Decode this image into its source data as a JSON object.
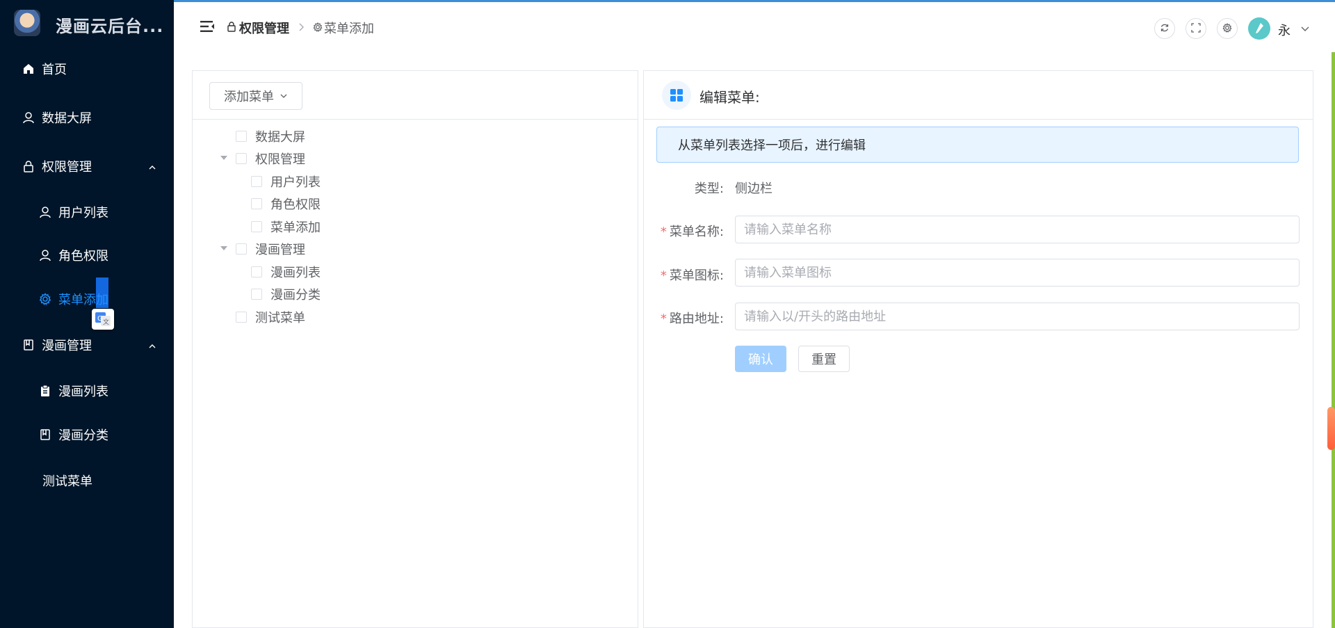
{
  "app": {
    "title": "漫画云后台..."
  },
  "sidebar": {
    "items": [
      {
        "label": "首页",
        "icon": "home-icon"
      },
      {
        "label": "数据大屏",
        "icon": "user-icon"
      },
      {
        "label": "权限管理",
        "icon": "lock-icon",
        "expanded": true
      },
      {
        "label": "用户列表",
        "icon": "user-icon"
      },
      {
        "label": "角色权限",
        "icon": "user-icon"
      },
      {
        "label": "菜单添加",
        "icon": "gear-icon",
        "active": true
      },
      {
        "label": "漫画管理",
        "icon": "book-icon",
        "expanded": true
      },
      {
        "label": "漫画列表",
        "icon": "clipboard-icon"
      },
      {
        "label": "漫画分类",
        "icon": "book-icon"
      },
      {
        "label": "测试菜单",
        "icon": ""
      }
    ],
    "accent_color": "#1e90ff",
    "background": "#001529"
  },
  "header": {
    "breadcrumb": [
      "权限管理",
      "菜单添加"
    ],
    "username": "永"
  },
  "tree_panel": {
    "add_button": "添加菜单",
    "nodes": [
      {
        "label": "数据大屏",
        "level": 0,
        "has_children": false
      },
      {
        "label": "权限管理",
        "level": 0,
        "has_children": true
      },
      {
        "label": "用户列表",
        "level": 1,
        "has_children": false
      },
      {
        "label": "角色权限",
        "level": 1,
        "has_children": false
      },
      {
        "label": "菜单添加",
        "level": 1,
        "has_children": false
      },
      {
        "label": "漫画管理",
        "level": 0,
        "has_children": true
      },
      {
        "label": "漫画列表",
        "level": 1,
        "has_children": false
      },
      {
        "label": "漫画分类",
        "level": 1,
        "has_children": false
      },
      {
        "label": "测试菜单",
        "level": 0,
        "has_children": false
      }
    ]
  },
  "edit_panel": {
    "title": "编辑菜单:",
    "alert": "从菜单列表选择一项后，进行编辑",
    "type_label": "类型:",
    "type_value": "侧边栏",
    "fields": {
      "name": {
        "label": "菜单名称:",
        "placeholder": "请输入菜单名称",
        "value": ""
      },
      "icon": {
        "label": "菜单图标:",
        "placeholder": "请输入菜单图标",
        "value": ""
      },
      "route": {
        "label": "路由地址:",
        "placeholder": "请输入以/开头的路由地址",
        "value": ""
      }
    },
    "confirm_label": "确认",
    "reset_label": "重置"
  }
}
